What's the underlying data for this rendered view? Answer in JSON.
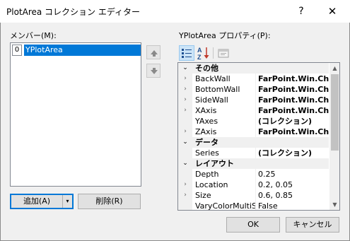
{
  "window": {
    "title": "PlotArea コレクション エディター",
    "help_glyph": "?",
    "close_glyph": "✕"
  },
  "members": {
    "label": "メンバー(M):",
    "items": [
      {
        "index": "0",
        "name": "YPlotArea",
        "selected": true
      }
    ]
  },
  "buttons": {
    "add": "追加(A)",
    "add_split_glyph": "▾",
    "delete": "削除(R)",
    "ok": "OK",
    "cancel": "キャンセル"
  },
  "properties": {
    "label": "YPlotArea プロパティ(P):",
    "toolbar": {
      "categorized_selected": true
    },
    "rows": [
      {
        "kind": "category",
        "label": "その他",
        "expander": "⌄"
      },
      {
        "kind": "prop",
        "name": "BackWall",
        "value": "FarPoint.Win.Chart",
        "expander": "›",
        "bold": true
      },
      {
        "kind": "prop",
        "name": "BottomWall",
        "value": "FarPoint.Win.Chart",
        "expander": "›",
        "bold": true
      },
      {
        "kind": "prop",
        "name": "SideWall",
        "value": "FarPoint.Win.Chart",
        "expander": "›",
        "bold": true
      },
      {
        "kind": "prop",
        "name": "XAxis",
        "value": "FarPoint.Win.Chart",
        "expander": "›",
        "bold": true
      },
      {
        "kind": "prop",
        "name": "YAxes",
        "value": "(コレクション)",
        "expander": "",
        "bold": true
      },
      {
        "kind": "prop",
        "name": "ZAxis",
        "value": "FarPoint.Win.Chart",
        "expander": "›",
        "bold": true
      },
      {
        "kind": "category",
        "label": "データ",
        "expander": "⌄"
      },
      {
        "kind": "prop",
        "name": "Series",
        "value": "(コレクション)",
        "expander": "",
        "bold": true
      },
      {
        "kind": "category",
        "label": "レイアウト",
        "expander": "⌄"
      },
      {
        "kind": "prop",
        "name": "Depth",
        "value": "0.25",
        "expander": "",
        "bold": false
      },
      {
        "kind": "prop",
        "name": "Location",
        "value": "0.2, 0.05",
        "expander": "›",
        "bold": false
      },
      {
        "kind": "prop",
        "name": "Size",
        "value": "0.6, 0.85",
        "expander": "›",
        "bold": false
      },
      {
        "kind": "prop",
        "name": "VaryColorMultiS",
        "value": "False",
        "expander": "",
        "bold": false
      }
    ]
  },
  "scrollbar": {
    "up_glyph": "▲",
    "down_glyph": "▼"
  }
}
